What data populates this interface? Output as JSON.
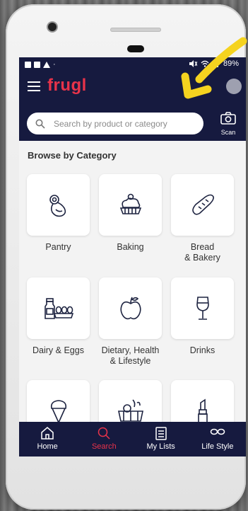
{
  "status_bar": {
    "battery": "89%"
  },
  "app": {
    "logo": "frugl"
  },
  "search": {
    "placeholder": "Search by product or category",
    "scan_label": "Scan"
  },
  "browse": {
    "title": "Browse by Category"
  },
  "categories": [
    {
      "label": "Pantry",
      "icon": "pacifier-icon"
    },
    {
      "label": "Baking",
      "icon": "cupcake-icon"
    },
    {
      "label": "Bread\n& Bakery",
      "icon": "bread-icon"
    },
    {
      "label": "Dairy & Eggs",
      "icon": "dairy-eggs-icon"
    },
    {
      "label": "Dietary, Health\n& Lifestyle",
      "icon": "apple-icon"
    },
    {
      "label": "Drinks",
      "icon": "wine-glass-icon"
    },
    {
      "label": "",
      "icon": "ice-cream-icon"
    },
    {
      "label": "",
      "icon": "vegetables-basket-icon"
    },
    {
      "label": "",
      "icon": "lipstick-icon"
    }
  ],
  "bottom_nav": [
    {
      "label": "Home",
      "icon": "home-icon"
    },
    {
      "label": "Search",
      "icon": "search-icon",
      "active": true
    },
    {
      "label": "My Lists",
      "icon": "list-icon"
    },
    {
      "label": "Life Style",
      "icon": "glasses-icon"
    }
  ],
  "colors": {
    "navy": "#161a3f",
    "brand_red": "#e8334a",
    "arrow_yellow": "#f5d31f"
  }
}
